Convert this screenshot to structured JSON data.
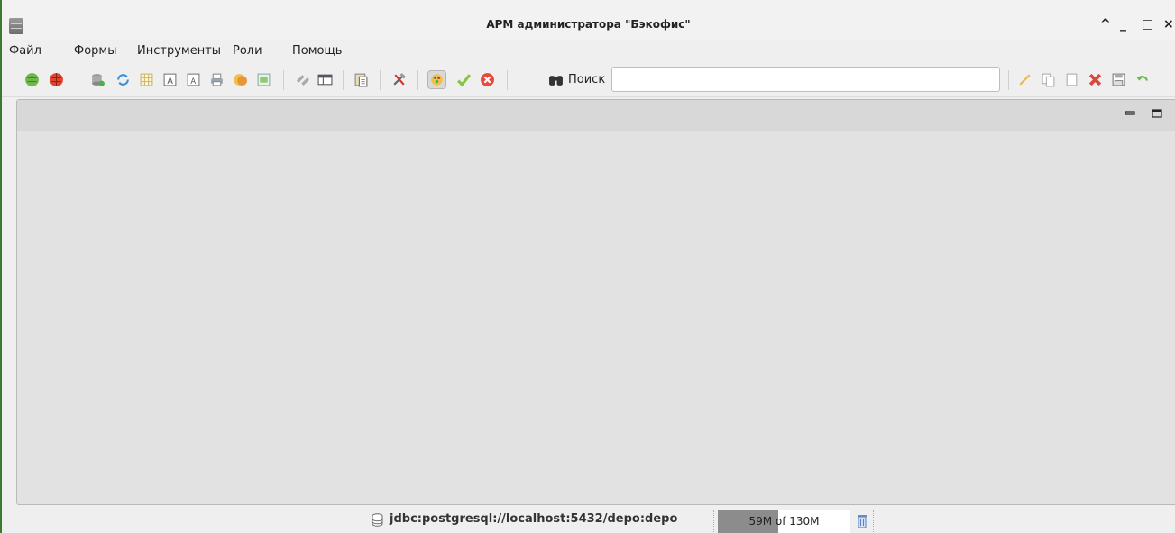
{
  "window": {
    "title": "АРМ администратора \"Бэкофис\"",
    "controls": {
      "collapse": "^",
      "minimize": "_",
      "maximize": "□",
      "close": "×"
    }
  },
  "menu": {
    "items": [
      "Файл",
      "Формы",
      "Инструменты",
      "Роли",
      "Помощь"
    ]
  },
  "toolbar": {
    "search_label": "Поиск",
    "search_value": "",
    "icons": [
      "globe-connect-icon",
      "globe-disconnect-icon",
      "database-add-icon",
      "refresh-icon",
      "grid-icon",
      "text-add-icon",
      "text-icon",
      "print-icon",
      "coins-icon",
      "report-icon",
      "link-icon",
      "window-list-icon",
      "clipboard-icon",
      "tools-icon",
      "palette-icon",
      "check-icon",
      "cancel-icon",
      "binoculars-icon",
      "edit-icon",
      "copy-icon",
      "new-doc-icon",
      "delete-icon",
      "save-icon",
      "undo-icon"
    ]
  },
  "statusbar": {
    "connection": "jdbc:postgresql://localhost:5432/depo:depo",
    "memory_text": "59M of 130M",
    "memory_used_fraction": 0.4538
  },
  "colors": {
    "accent_green": "#3c7a2e",
    "memory_fill": "#8c8c8c"
  }
}
